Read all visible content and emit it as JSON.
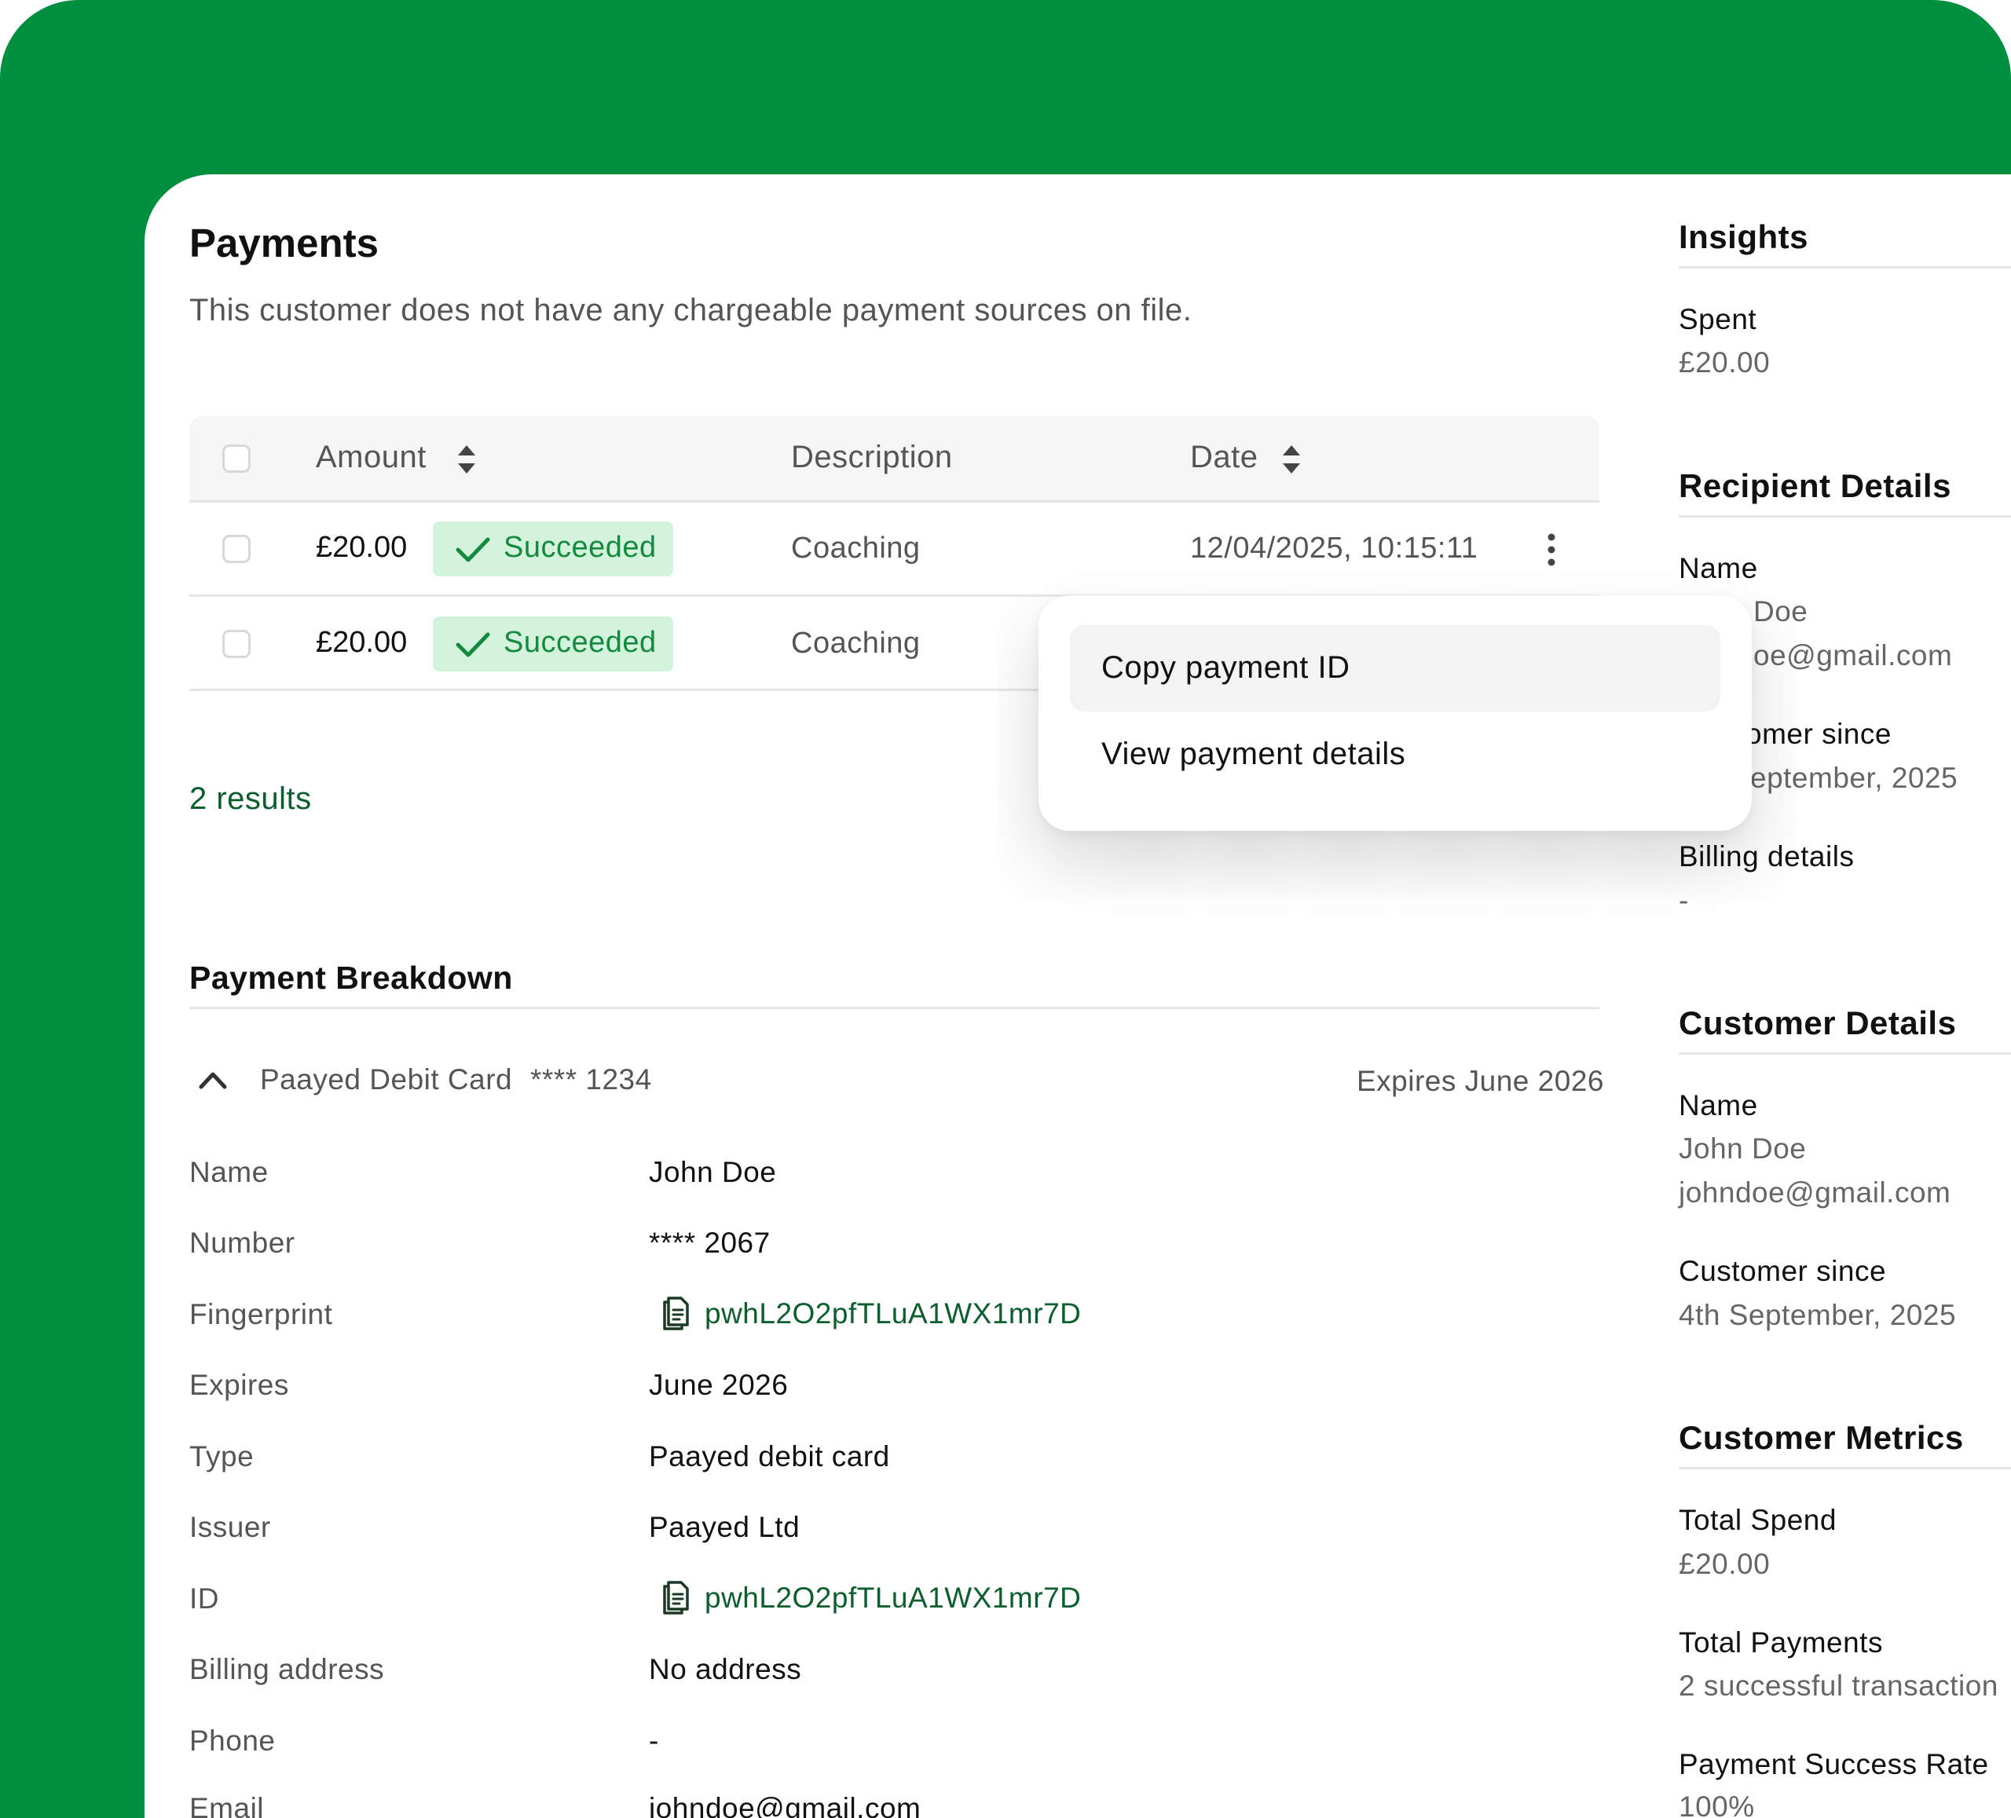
{
  "payments": {
    "title": "Payments",
    "subtitle": "This customer does not have any chargeable payment sources on file.",
    "columns": {
      "amount": "Amount",
      "description": "Description",
      "date": "Date"
    },
    "rows": [
      {
        "amount": "£20.00",
        "status": "Succeeded",
        "description": "Coaching",
        "date": "12/04/2025, 10:15:11"
      },
      {
        "amount": "£20.00",
        "status": "Succeeded",
        "description": "Coaching",
        "date": ""
      }
    ],
    "results": "2 results"
  },
  "context_menu": {
    "copy_id": "Copy payment ID",
    "view_details": "View payment details"
  },
  "breakdown": {
    "title": "Payment Breakdown",
    "card_name": "Paayed Debit Card",
    "card_mask": "**** 1234",
    "card_expiry": "Expires June 2026",
    "fields": [
      {
        "label": "Name",
        "value": "John Doe"
      },
      {
        "label": "Number",
        "value": "**** 2067"
      },
      {
        "label": "Fingerprint",
        "value": "pwhL2O2pfTLuA1WX1mr7D"
      },
      {
        "label": "Expires",
        "value": "June 2026"
      },
      {
        "label": "Type",
        "value": "Paayed debit card"
      },
      {
        "label": "Issuer",
        "value": "Paayed Ltd"
      },
      {
        "label": "ID",
        "value": "pwhL2O2pfTLuA1WX1mr7D"
      },
      {
        "label": "Billing address",
        "value": "No address"
      },
      {
        "label": "Phone",
        "value": "-"
      },
      {
        "label": "Email",
        "value": "johndoe@gmail.com"
      }
    ]
  },
  "sidebar": {
    "insights": {
      "title": "Insights",
      "spent_label": "Spent",
      "spent_value": "£20.00"
    },
    "recipient": {
      "title": "Recipient Details",
      "name_label": "Name",
      "name_value": "Doe",
      "email_value": "oe@gmail.com",
      "since_label": "omer since",
      "since_value": "eptember, 2025",
      "billing_label": "Billing details",
      "billing_value": "-"
    },
    "customer": {
      "title": "Customer Details",
      "name_label": "Name",
      "name_value": "John Doe",
      "email_value": "johndoe@gmail.com",
      "since_label": "Customer since",
      "since_value": "4th September, 2025"
    },
    "metrics": {
      "title": "Customer Metrics",
      "total_spend_label": "Total Spend",
      "total_spend_value": "£20.00",
      "total_payments_label": "Total Payments",
      "total_payments_value": "2 successful transaction",
      "success_rate_label": "Payment Success Rate",
      "success_rate_value": "100%"
    }
  },
  "colors": {
    "brand_green": "#008f3e",
    "success_bg": "#d4f3dd",
    "success_text": "#138a3e",
    "link_green": "#0a5f2c"
  },
  "icons": {
    "sort": "sort-icon",
    "check": "check-icon",
    "kebab": "kebab-menu-icon",
    "chevron": "chevron-up-icon",
    "copy": "copy-icon"
  }
}
